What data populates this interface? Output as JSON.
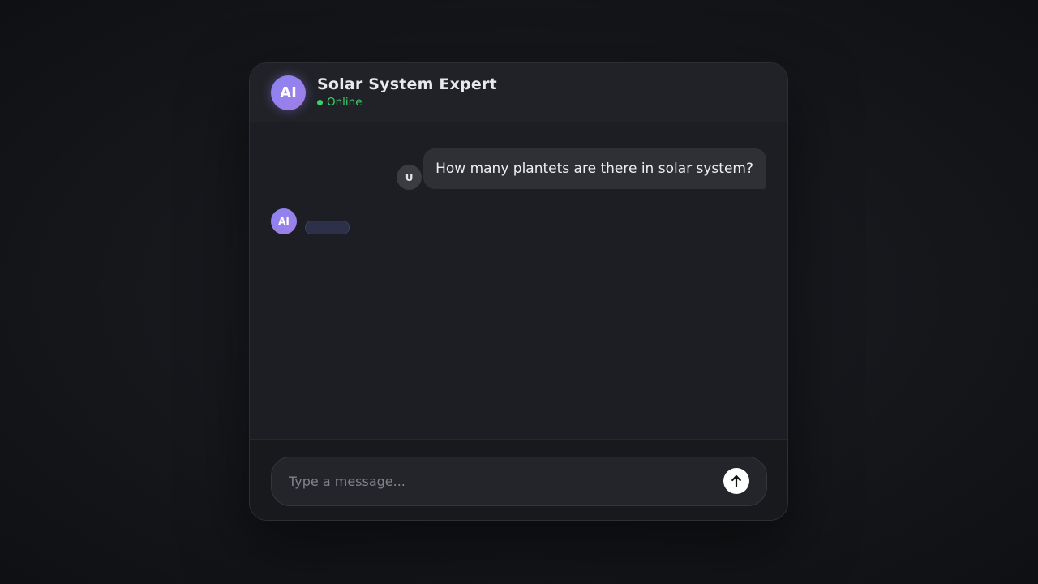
{
  "header": {
    "avatar_label": "AI",
    "title": "Solar System Expert",
    "status": "Online",
    "status_color": "#3ccf6e"
  },
  "messages": [
    {
      "role": "user",
      "avatar_label": "U",
      "text": "How many plantets are there in solar system?"
    },
    {
      "role": "assistant",
      "avatar_label": "AI",
      "text": ""
    }
  ],
  "composer": {
    "placeholder": "Type a message...",
    "value": "",
    "send_icon": "arrow-up-icon"
  },
  "colors": {
    "accent": "#8a83f2",
    "background": "#1c1e23"
  }
}
